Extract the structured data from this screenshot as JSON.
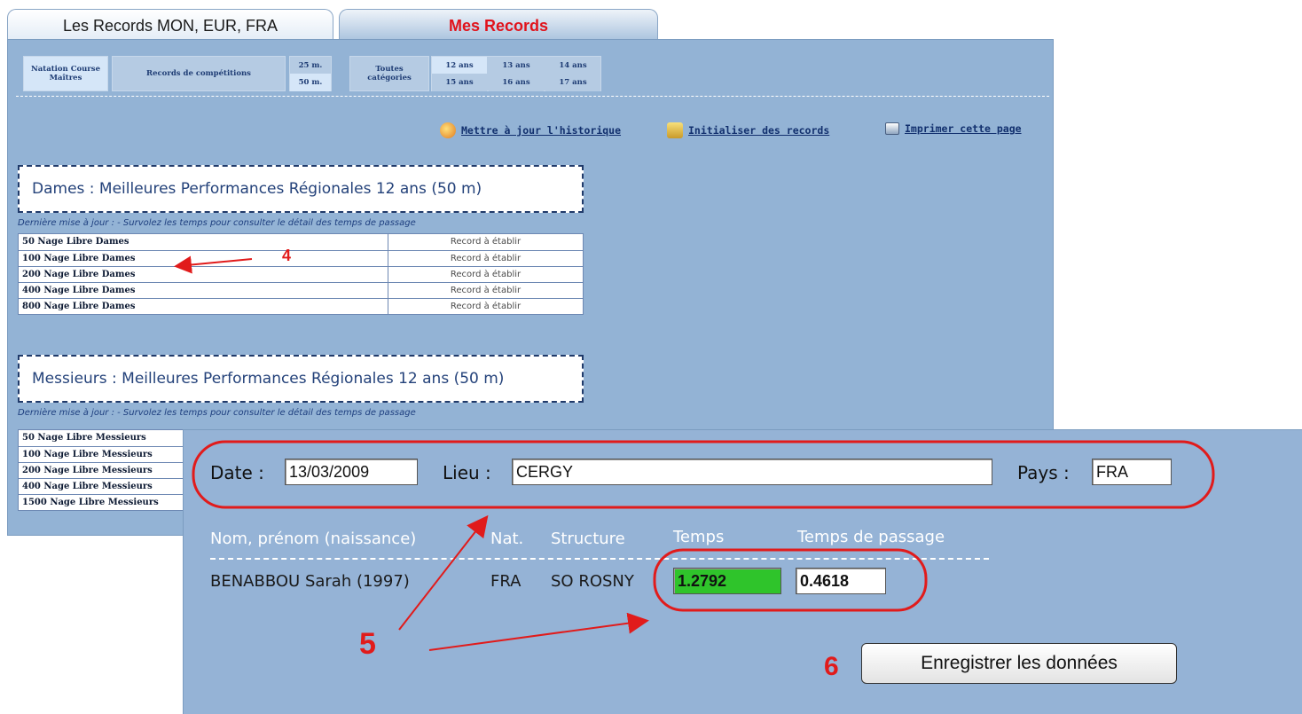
{
  "tabs": [
    {
      "label": "Les Records MON, EUR, FRA"
    },
    {
      "label": "Mes Records"
    }
  ],
  "filters": {
    "discipline": [
      "Natation Course",
      "Maîtres"
    ],
    "record_type": "Records de compétitions",
    "pool": [
      "25 m.",
      "50 m."
    ],
    "category_all": [
      "Toutes",
      "catégories"
    ],
    "ages": [
      "12 ans",
      "13 ans",
      "14 ans",
      "15 ans",
      "16 ans",
      "17 ans"
    ]
  },
  "actions": {
    "update_history": "Mettre à jour l'historique",
    "init_records": "Initialiser des records",
    "print_page": "Imprimer cette page"
  },
  "ladies": {
    "title": "Dames : Meilleures Performances Régionales 12 ans (50 m)",
    "subtitle": "Dernière mise à jour :   -   Survolez les temps pour consulter le détail des temps de passage",
    "rows": [
      {
        "event": "50 Nage Libre Dames",
        "value": "Record à établir"
      },
      {
        "event": "100 Nage Libre Dames",
        "value": "Record à établir"
      },
      {
        "event": "200 Nage Libre Dames",
        "value": "Record à établir"
      },
      {
        "event": "400 Nage Libre Dames",
        "value": "Record à établir"
      },
      {
        "event": "800 Nage Libre Dames",
        "value": "Record à établir"
      }
    ]
  },
  "men": {
    "title": "Messieurs : Meilleures Performances Régionales 12 ans (50 m)",
    "subtitle": "Dernière mise à jour :   -   Survolez les temps pour consulter le détail des temps de passage",
    "rows": [
      {
        "event": "50 Nage Libre Messieurs"
      },
      {
        "event": "100 Nage Libre Messieurs"
      },
      {
        "event": "200 Nage Libre Messieurs"
      },
      {
        "event": "400 Nage Libre Messieurs"
      },
      {
        "event": "1500 Nage Libre Messieurs"
      }
    ]
  },
  "form": {
    "date_label": "Date :",
    "date_value": "13/03/2009",
    "place_label": "Lieu :",
    "place_value": "CERGY",
    "country_label": "Pays :",
    "country_value": "FRA",
    "headers": [
      "Nom, prénom (naissance)",
      "Nat.",
      "Structure",
      "Temps",
      "Temps de passage"
    ],
    "swimmer": {
      "name": "BENABBOU Sarah (1997)",
      "nat": "FRA",
      "club": "SO ROSNY"
    },
    "time_value": "1.2792",
    "split_value": "0.4618",
    "save_label": "Enregistrer les données"
  },
  "steps": [
    "4",
    "5",
    "6"
  ],
  "colors": {
    "panel": "#93b3d5",
    "active_tab_text": "#e1131b",
    "annotation_red": "#e11b1b",
    "time_field_green": "#2fc42b"
  }
}
